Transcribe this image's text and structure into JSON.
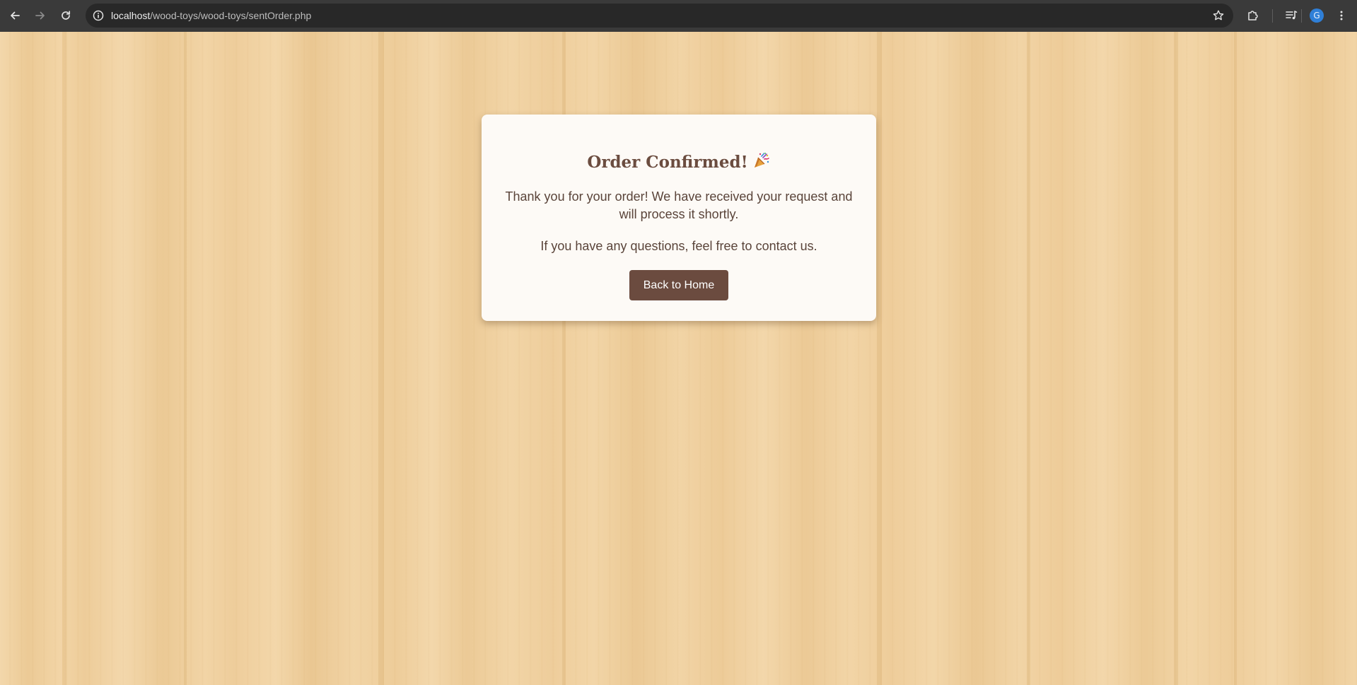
{
  "browser": {
    "url_host": "localhost",
    "url_path": "/wood-toys/wood-toys/sentOrder.php",
    "profile_initial": "G",
    "icons": {
      "back": "arrow-left-icon",
      "forward": "arrow-right-icon",
      "reload": "reload-icon",
      "site_info": "info-circle-icon",
      "bookmark": "star-icon",
      "extensions": "puzzle-icon",
      "media": "queue-music-icon",
      "menu": "kebab-menu-icon"
    }
  },
  "confirmation": {
    "title": "Order Confirmed!",
    "title_icon": "party-popper-icon",
    "message_received": "Thank you for your order! We have received your request and will process it shortly.",
    "message_contact": "If you have any questions, feel free to contact us.",
    "home_button_label": "Back to Home"
  },
  "colors": {
    "chrome_bg": "#3a3a3a",
    "omnibox_bg": "#282828",
    "card_bg": "#fdfaf6",
    "title_color": "#6b4c3f",
    "text_color": "#5a443a",
    "button_bg": "#6b4b3f",
    "button_text": "#ffffff",
    "wood_base": "#efcf9e",
    "avatar_bg": "#2f7fd7"
  }
}
